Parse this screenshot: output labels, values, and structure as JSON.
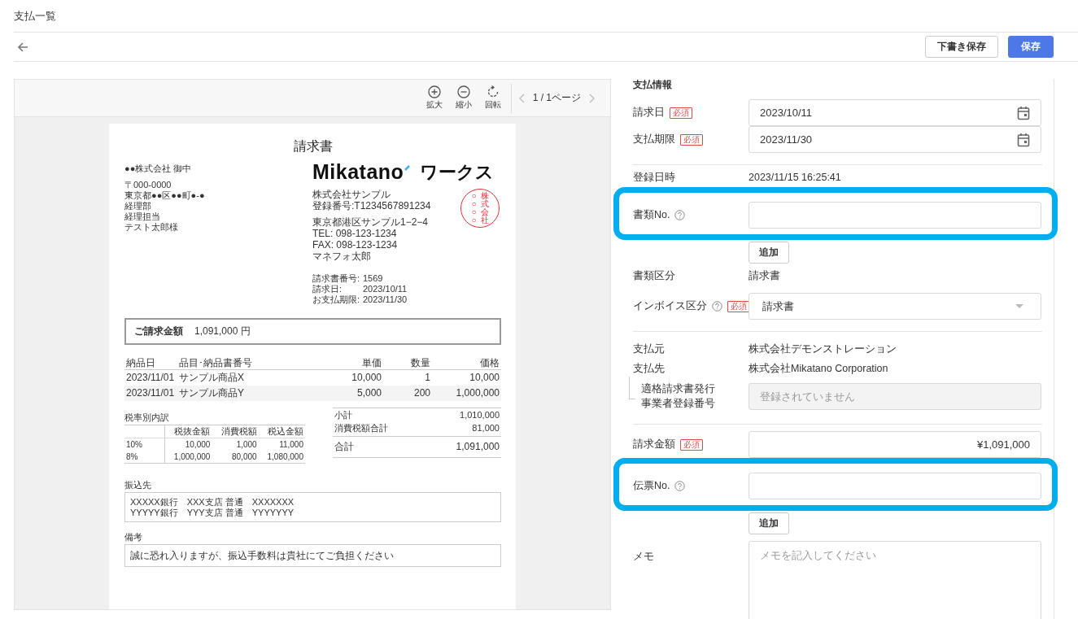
{
  "page_title": "支払一覧",
  "header": {
    "buttons": [
      {
        "label": "下書き保存",
        "kind": "secondary"
      },
      {
        "label": "保存",
        "kind": "primary"
      }
    ]
  },
  "viewer": {
    "tools": [
      {
        "label": "拡大",
        "kind": "zoom-in"
      },
      {
        "label": "縮小",
        "kind": "zoom-out"
      },
      {
        "label": "回転",
        "kind": "rotate"
      }
    ],
    "page_indicator": "1 / 1ページ"
  },
  "invoice": {
    "title": "請求書",
    "recipient": "●●株式会社 御中",
    "recipient_address": [
      "〒000-0000",
      "東京都●●区●●町●-●",
      "経理部",
      "経理担当",
      "テスト太郎様"
    ],
    "logo": {
      "name": "Mikatano",
      "suffix": "ワークス"
    },
    "issuer": [
      "株式会社サンプル",
      "登録番号:T1234567891234"
    ],
    "issuer_contact": [
      "東京都港区サンプル1−2−4",
      "TEL: 098-123-1234",
      "FAX: 098-123-1234",
      "マネフォ太郎"
    ],
    "stamp": [
      "○○○○",
      "株式会社"
    ],
    "meta": [
      {
        "label": "請求書番号:",
        "value": "1569"
      },
      {
        "label": "請求日:",
        "value": "2023/10/11"
      },
      {
        "label": "お支払期限:",
        "value": "2023/11/30"
      }
    ],
    "total_label": "ご請求金額",
    "total_value": "1,091,000 円",
    "items": {
      "columns": [
        "納品日",
        "品目･納品書番号",
        "単価",
        "数量",
        "価格"
      ],
      "rows": [
        [
          "2023/11/01",
          "サンプル商品X",
          "10,000",
          "1",
          "10,000"
        ],
        [
          "2023/11/01",
          "サンプル商品Y",
          "5,000",
          "200",
          "1,000,000"
        ]
      ]
    },
    "tax": {
      "title": "税率別内訳",
      "columns": [
        "",
        "税抜金額",
        "消費税額",
        "税込金額"
      ],
      "rows": [
        [
          "10%",
          "10,000",
          "1,000",
          "11,000"
        ],
        [
          "8%",
          "1,000,000",
          "80,000",
          "1,080,000"
        ]
      ]
    },
    "summary": [
      {
        "label": "小計",
        "value": "1,010,000",
        "kind": "normal"
      },
      {
        "label": "消費税額合計",
        "value": "81,000",
        "kind": "normal"
      },
      {
        "label": "合計",
        "value": "1,091,000",
        "kind": "grand"
      }
    ],
    "bank_label": "振込先",
    "bank_lines": [
      "XXXXX銀行　XXX支店 普通　XXXXXXX",
      "YYYYY銀行　YYY支店 普通　YYYYYYY"
    ],
    "notes_label": "備考",
    "notes": "誠に恐れ入りますが、振込手数料は貴社にてご負担ください"
  },
  "form": {
    "section_title": "支払情報",
    "rows": [
      {
        "kind": "date",
        "label": "請求日",
        "badge": "必須",
        "value": "2023/10/11"
      },
      {
        "kind": "date",
        "label": "支払期限",
        "badge": "必須",
        "value": "2023/11/30"
      },
      {
        "kind": "divider"
      },
      {
        "kind": "text",
        "label": "登録日時",
        "value": "2023/11/15 16:25:41"
      },
      {
        "kind": "input",
        "label": "書類No.",
        "help": true,
        "highlighted": true,
        "add_button": "追加"
      },
      {
        "kind": "text",
        "label": "書類区分",
        "value": "請求書"
      },
      {
        "kind": "select",
        "label": "インボイス区分",
        "help": true,
        "badge": "必須",
        "value": "請求書"
      },
      {
        "kind": "divider"
      },
      {
        "kind": "text",
        "label": "支払元",
        "value": "株式会社デモンストレーション"
      },
      {
        "kind": "text",
        "label": "支払先",
        "value": "株式会社Mikatano Corporation"
      },
      {
        "kind": "disabled",
        "label_lines": [
          "適格請求書発行",
          "事業者登録番号"
        ],
        "placeholder": "登録されていません"
      },
      {
        "kind": "divider"
      },
      {
        "kind": "amount",
        "label": "請求金額",
        "badge": "必須",
        "value": "¥1,091,000"
      },
      {
        "kind": "input",
        "label": "伝票No.",
        "help": true,
        "highlighted": true,
        "add_button": "追加"
      },
      {
        "kind": "textarea",
        "label": "メモ",
        "placeholder": "メモを記入してください"
      }
    ]
  }
}
